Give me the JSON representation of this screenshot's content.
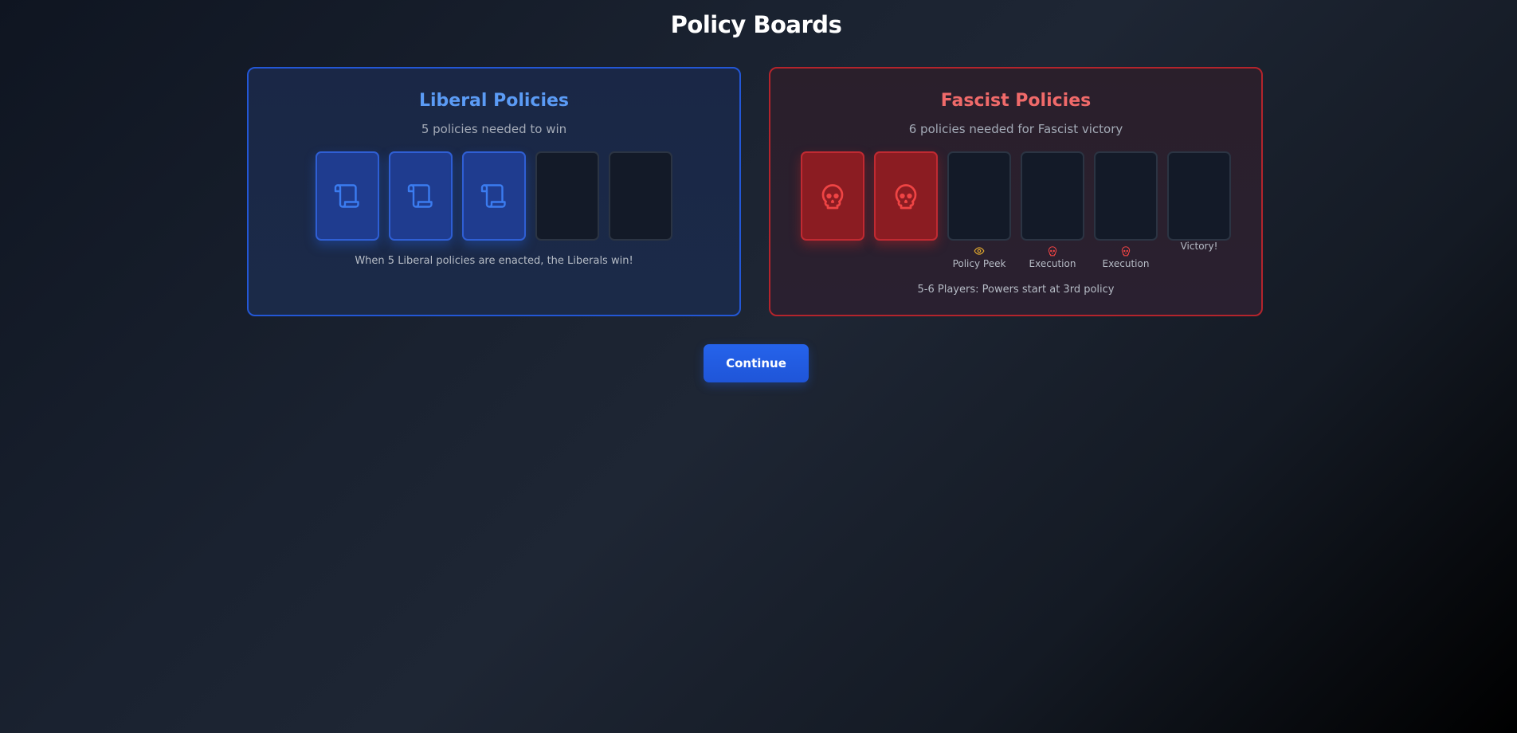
{
  "page": {
    "title": "Policy Boards"
  },
  "liberal_board": {
    "title": "Liberal Policies",
    "subtitle": "5 policies needed to win",
    "total_slots": 5,
    "enacted": 3,
    "card_icon": "scroll-icon",
    "note": "When 5 Liberal policies are enacted, the Liberals win!",
    "accent_color": "#5b9bf5"
  },
  "fascist_board": {
    "title": "Fascist Policies",
    "subtitle": "6 policies needed for Fascist victory",
    "total_slots": 6,
    "enacted": 2,
    "card_icon": "skull-icon",
    "powers": [
      {
        "slot": 3,
        "label": "Policy Peek",
        "icon": "eye-icon",
        "color": "#e0a82e"
      },
      {
        "slot": 4,
        "label": "Execution",
        "icon": "skull-icon",
        "color": "#ef4444"
      },
      {
        "slot": 5,
        "label": "Execution",
        "icon": "skull-icon",
        "color": "#ef4444"
      },
      {
        "slot": 6,
        "label": "Victory!",
        "icon": "",
        "color": ""
      }
    ],
    "note": "5-6 Players: Powers start at 3rd policy",
    "accent_color": "#f06a6a"
  },
  "actions": {
    "continue_label": "Continue"
  }
}
